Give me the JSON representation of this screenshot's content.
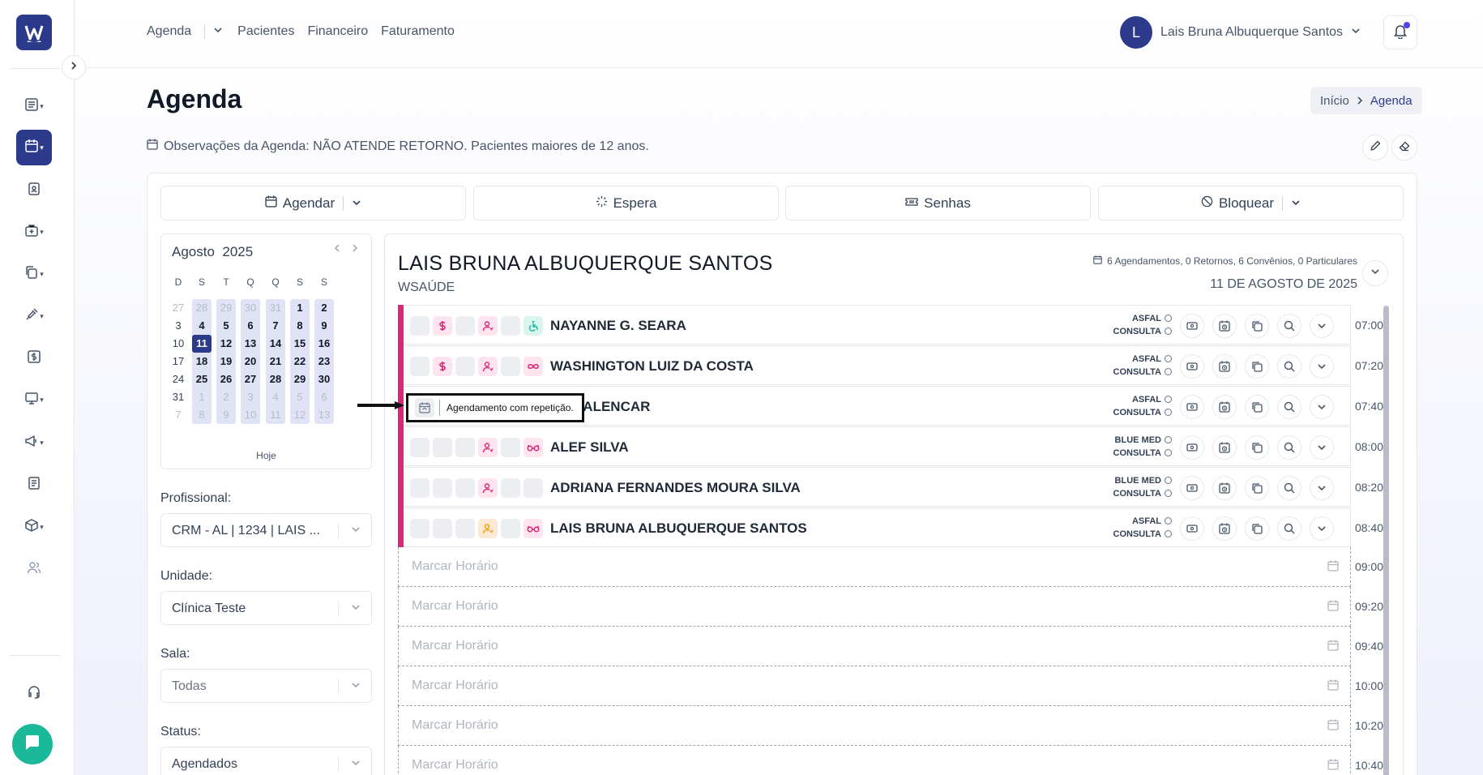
{
  "topbar": {
    "nav": [
      "Agenda",
      "Pacientes",
      "Financeiro",
      "Faturamento"
    ],
    "user_initial": "L",
    "user_name": "Lais Bruna Albuquerque Santos"
  },
  "page": {
    "title": "Agenda",
    "breadcrumb": [
      "Início",
      "Agenda"
    ],
    "observations": "Observações da Agenda: NÃO ATENDE RETORNO. Pacientes maiores de 12 anos."
  },
  "actions": {
    "agendar": "Agendar",
    "espera": "Espera",
    "senhas": "Senhas",
    "bloquear": "Bloquear"
  },
  "calendar": {
    "month": "Agosto",
    "year": "2025",
    "weekdays": [
      "D",
      "S",
      "T",
      "Q",
      "Q",
      "S",
      "S"
    ],
    "weeks": [
      [
        "27",
        "28",
        "29",
        "30",
        "31",
        "1",
        "2"
      ],
      [
        "3",
        "4",
        "5",
        "6",
        "7",
        "8",
        "9"
      ],
      [
        "10",
        "11",
        "12",
        "13",
        "14",
        "15",
        "16"
      ],
      [
        "17",
        "18",
        "19",
        "20",
        "21",
        "22",
        "23"
      ],
      [
        "24",
        "25",
        "26",
        "27",
        "28",
        "29",
        "30"
      ],
      [
        "31",
        "1",
        "2",
        "3",
        "4",
        "5",
        "6"
      ],
      [
        "7",
        "8",
        "9",
        "10",
        "11",
        "12",
        "13"
      ]
    ],
    "selected": "11",
    "today_label": "Hoje"
  },
  "filters": {
    "profissional_label": "Profissional:",
    "profissional_value": "CRM - AL | 1234 | LAIS ...",
    "unidade_label": "Unidade:",
    "unidade_value": "Clínica Teste",
    "sala_label": "Sala:",
    "sala_value": "Todas",
    "status_label": "Status:",
    "status_value": "Agendados"
  },
  "schedule": {
    "doctor": "LAIS BRUNA ALBUQUERQUE SANTOS",
    "clinic": "WSAÚDE",
    "summary": [
      "6 Agendamentos",
      "0 Retornos",
      "6 Convênios",
      "0 Particulares"
    ],
    "date": "11 DE AGOSTO DE 2025",
    "appointments": [
      {
        "name": "NAYANNE G. SEARA",
        "insurance": "ASFAL",
        "type": "CONSULTA",
        "time": "07:00"
      },
      {
        "name": "WASHINGTON LUIZ DA COSTA",
        "insurance": "ASFAL",
        "type": "CONSULTA",
        "time": "07:20"
      },
      {
        "name": "ANA ALENCAR",
        "insurance": "ASFAL",
        "type": "CONSULTA",
        "time": "07:40"
      },
      {
        "name": "ALEF SILVA",
        "insurance": "BLUE MED",
        "type": "CONSULTA",
        "time": "08:00"
      },
      {
        "name": "ADRIANA FERNANDES MOURA SILVA",
        "insurance": "BLUE MED",
        "type": "CONSULTA",
        "time": "08:20"
      },
      {
        "name": "LAIS BRUNA ALBUQUERQUE SANTOS",
        "insurance": "ASFAL",
        "type": "CONSULTA",
        "time": "08:40"
      }
    ],
    "slot_placeholder": "Marcar Horário",
    "slot_times": [
      "09:00",
      "09:20",
      "09:40",
      "10:00",
      "10:20",
      "10:40"
    ]
  },
  "tooltip": "Agendamento com repetição.",
  "colors": {
    "brand": "#2c3a8c",
    "row_bar": "#db2777",
    "chat": "#1bb99a"
  }
}
